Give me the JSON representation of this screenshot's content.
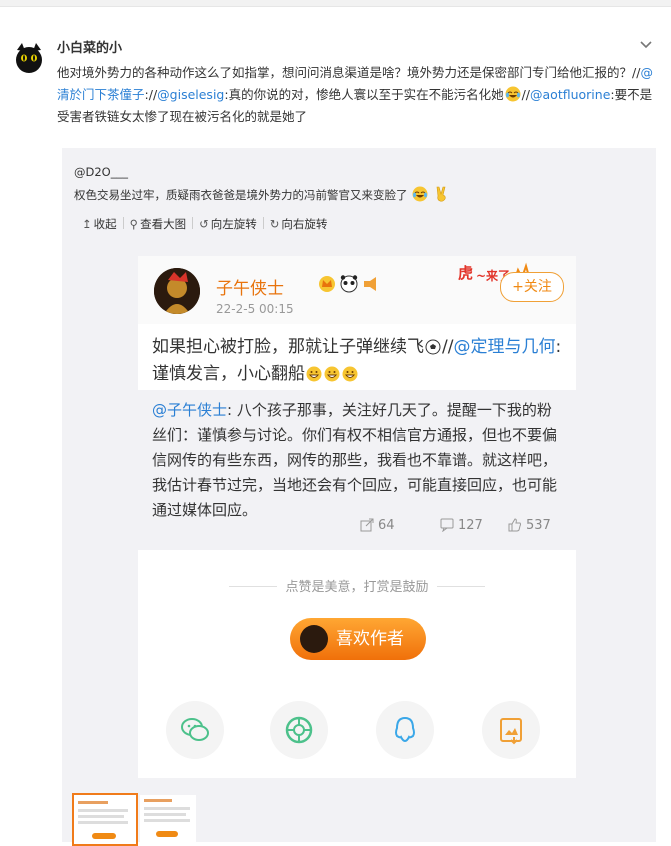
{
  "comment": {
    "username": "小白菜的小",
    "text_part1": "他对境外势力的各种动作这么了如指掌，想问问消息渠道是啥？境外势力还是保密部门专门给他汇报的？//",
    "mention1": "@清於门下茶僮子",
    "text_part2": "://",
    "mention2": "@giselesig",
    "text_part3": ":真的你说的对，惨绝人寰以至于实在不能污名化她",
    "text_part4": "//",
    "mention3": "@aotfluorine",
    "text_part5": ":要不是受害者铁链女太惨了现在被污名化的就是她了"
  },
  "repost": {
    "username": "@D2O___",
    "text": "权色交易坐过牢，质疑雨衣爸爸是境外势力的冯前警官又来变脸了",
    "actions": {
      "collapse": "收起",
      "view_large": "查看大图",
      "rotate_left": "向左旋转",
      "rotate_right": "向右旋转"
    }
  },
  "card": {
    "name": "子午侠士",
    "date": "22-2-5 00:15",
    "follow_label": "+关注",
    "main_text1": "如果担心被打脸，那就让子弹继续飞",
    "main_text2": "//",
    "main_mention": "@定理与几何",
    "main_text3": ":谨慎发言，小心翻船",
    "quote_mention": "@子午侠士",
    "quote_text": ": 八个孩子那事，关注好几天了。提醒一下我的粉丝们：谨慎参与讨论。你们有权不相信官方通报，但也不要偏信网传的有些东西，网传的那些，我看也不靠谱。就这样吧，我估计春节过完，当地还会有个回应，可能直接回应，也可能通过媒体回应。",
    "reposts": "64",
    "comments": "127",
    "likes": "537",
    "reward_line": "点赞是美意，打赏是鼓励",
    "like_author": "喜欢作者"
  },
  "icons": [
    "chevron-down-icon",
    "collapse-icon",
    "search-icon",
    "rotate-left-icon",
    "rotate-right-icon",
    "repost-icon",
    "comment-icon",
    "like-icon",
    "wechat-icon",
    "moments-icon",
    "qq-icon",
    "save-image-icon"
  ],
  "colors": {
    "accent": "#f08a14",
    "mention": "#2a7fd4",
    "background_repost": "#f2f2f5"
  }
}
